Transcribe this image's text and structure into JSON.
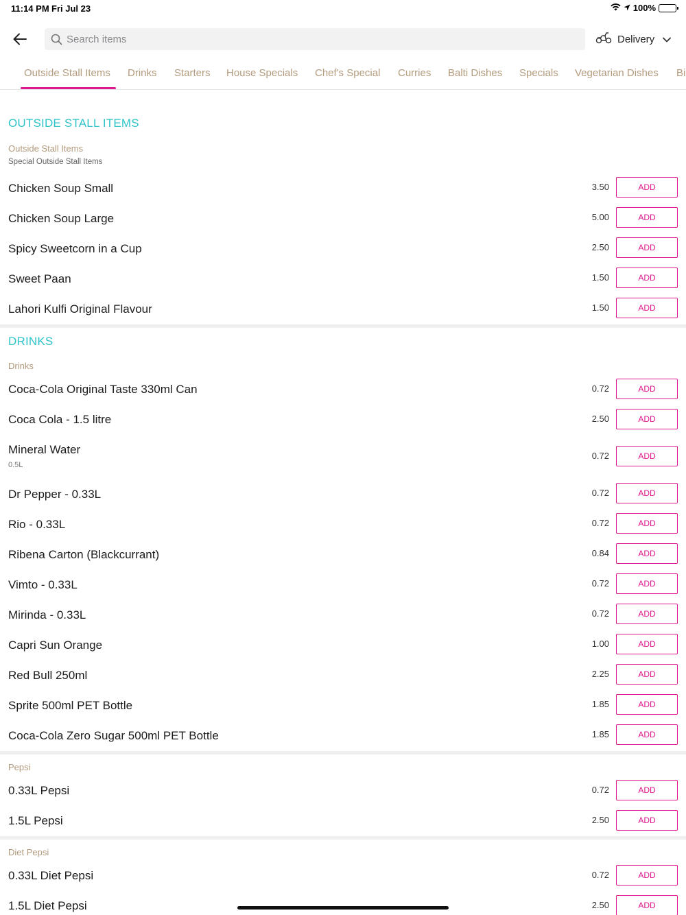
{
  "status_bar": {
    "time": "11:14 PM",
    "date": "Fri Jul 23",
    "battery": "100%"
  },
  "search": {
    "placeholder": "Search items"
  },
  "delivery": {
    "label": "Delivery"
  },
  "tabs": [
    {
      "label": "Outside Stall Items",
      "active": true
    },
    {
      "label": "Drinks"
    },
    {
      "label": "Starters"
    },
    {
      "label": "House Specials"
    },
    {
      "label": "Chef's Special"
    },
    {
      "label": "Curries"
    },
    {
      "label": "Balti Dishes"
    },
    {
      "label": "Specials"
    },
    {
      "label": "Vegetarian Dishes"
    },
    {
      "label": "Bi"
    }
  ],
  "colors": {
    "accent": "#e0168f",
    "section_title": "#2ec4c9",
    "subtitle": "#b29a7c"
  },
  "sections": {
    "outside": {
      "title": "OUTSIDE STALL ITEMS",
      "subtitle": "Outside Stall Items",
      "description": "Special Outside Stall Items",
      "items": [
        {
          "name": "Chicken Soup Small",
          "price": "3.50",
          "button": "ADD"
        },
        {
          "name": "Chicken Soup Large",
          "price": "5.00",
          "button": "ADD"
        },
        {
          "name": "Spicy Sweetcorn in a Cup",
          "price": "2.50",
          "button": "ADD"
        },
        {
          "name": "Sweet Paan",
          "price": "1.50",
          "button": "ADD"
        },
        {
          "name": "Lahori Kulfi Original Flavour",
          "price": "1.50",
          "button": "ADD"
        }
      ]
    },
    "drinks": {
      "title": "DRINKS",
      "subtitle": "Drinks",
      "items": [
        {
          "name": "Coca-Cola Original Taste 330ml Can",
          "price": "0.72",
          "button": "ADD"
        },
        {
          "name": "Coca Cola - 1.5 litre",
          "price": "2.50",
          "button": "ADD"
        },
        {
          "name": "Mineral Water",
          "note": "0.5L",
          "price": "0.72",
          "button": "ADD"
        },
        {
          "name": "Dr Pepper - 0.33L",
          "price": "0.72",
          "button": "ADD"
        },
        {
          "name": "Rio - 0.33L",
          "price": "0.72",
          "button": "ADD"
        },
        {
          "name": "Ribena Carton (Blackcurrant)",
          "price": "0.84",
          "button": "ADD"
        },
        {
          "name": "Vimto - 0.33L",
          "price": "0.72",
          "button": "ADD"
        },
        {
          "name": "Mirinda - 0.33L",
          "price": "0.72",
          "button": "ADD"
        },
        {
          "name": "Capri Sun Orange",
          "price": "1.00",
          "button": "ADD"
        },
        {
          "name": "Red Bull 250ml",
          "price": "2.25",
          "button": "ADD"
        },
        {
          "name": "Sprite 500ml PET Bottle",
          "price": "1.85",
          "button": "ADD"
        },
        {
          "name": "Coca-Cola Zero Sugar 500ml PET Bottle",
          "price": "1.85",
          "button": "ADD"
        }
      ]
    },
    "pepsi": {
      "subtitle": "Pepsi",
      "items": [
        {
          "name": "0.33L Pepsi",
          "price": "0.72",
          "button": "ADD"
        },
        {
          "name": "1.5L Pepsi",
          "price": "2.50",
          "button": "ADD"
        }
      ]
    },
    "diet_pepsi": {
      "subtitle": "Diet Pepsi",
      "items": [
        {
          "name": "0.33L Diet Pepsi",
          "price": "0.72",
          "button": "ADD"
        },
        {
          "name": "1.5L Diet Pepsi",
          "price": "2.50",
          "button": "ADD"
        }
      ]
    }
  }
}
